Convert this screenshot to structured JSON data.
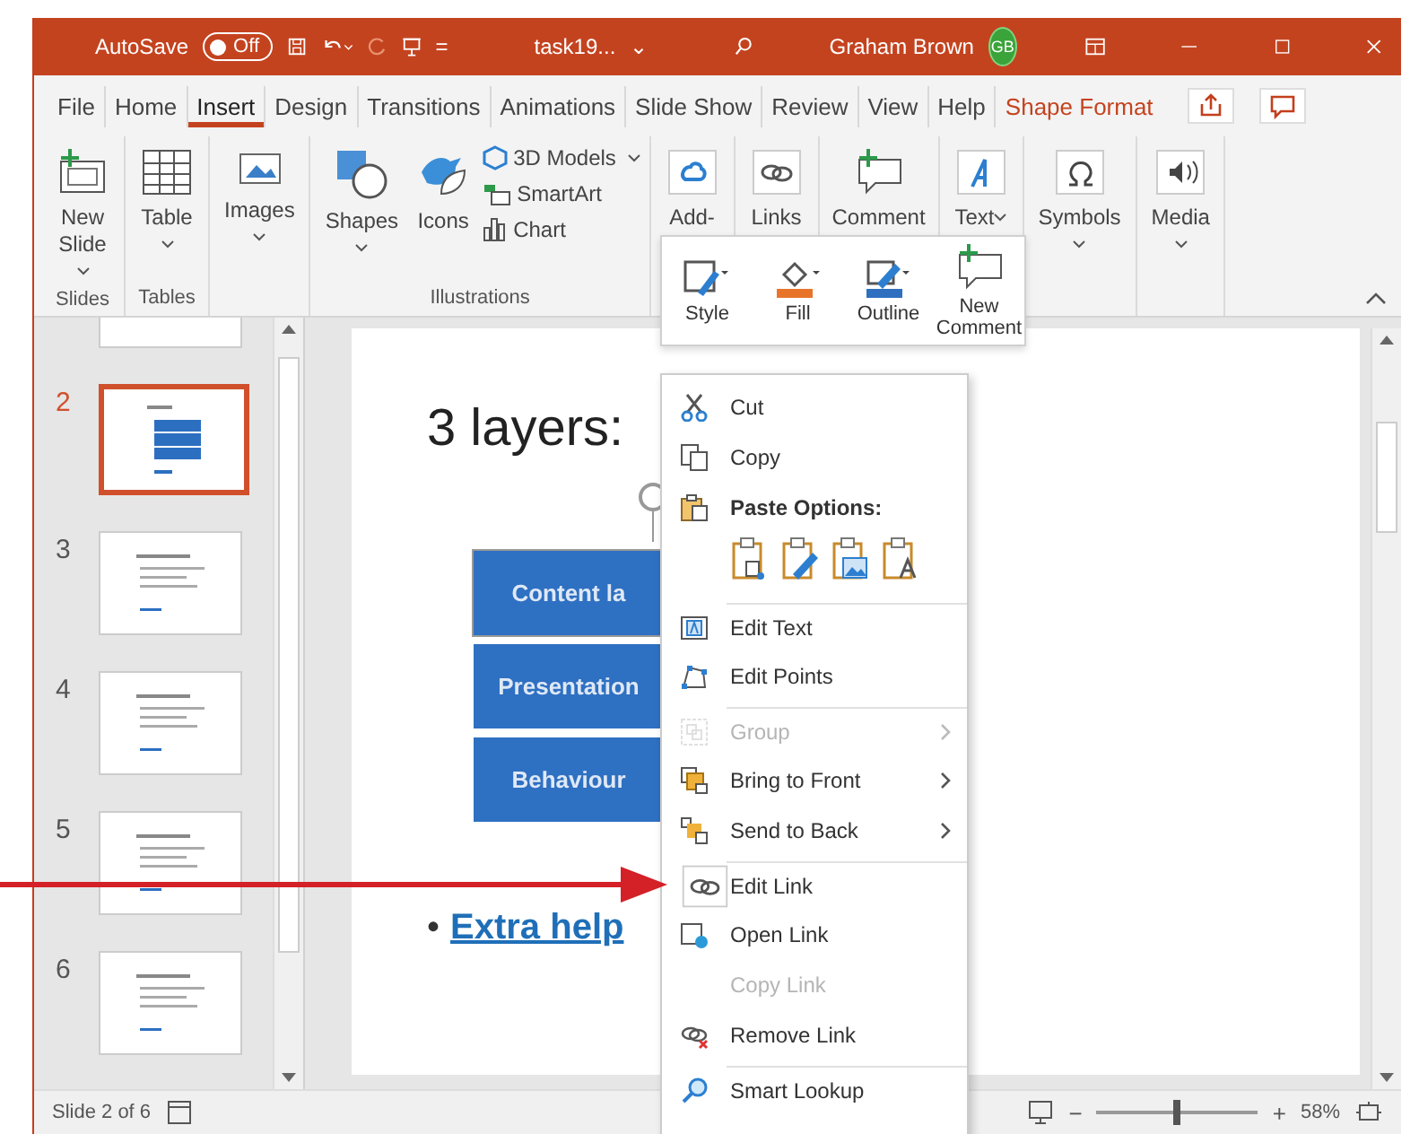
{
  "title_bar": {
    "autosave_label": "AutoSave",
    "autosave_toggle": {
      "label": "Off",
      "on": false
    },
    "customize": "=",
    "file_name": "task19...",
    "file_caret": "⌄",
    "user_name": "Graham Brown",
    "avatar": "GB"
  },
  "tabs": [
    {
      "label": "File",
      "selected": false,
      "kind": "normal"
    },
    {
      "label": "Home",
      "selected": false,
      "kind": "normal"
    },
    {
      "label": "Insert",
      "selected": true,
      "kind": "normal"
    },
    {
      "label": "Design",
      "selected": false,
      "kind": "normal"
    },
    {
      "label": "Transitions",
      "selected": false,
      "kind": "normal"
    },
    {
      "label": "Animations",
      "selected": false,
      "kind": "normal"
    },
    {
      "label": "Slide Show",
      "selected": false,
      "kind": "normal"
    },
    {
      "label": "Review",
      "selected": false,
      "kind": "normal"
    },
    {
      "label": "View",
      "selected": false,
      "kind": "normal"
    },
    {
      "label": "Help",
      "selected": false,
      "kind": "normal"
    },
    {
      "label": "Shape Format",
      "selected": false,
      "kind": "contextual"
    }
  ],
  "ribbon": {
    "groups": [
      {
        "label": "Slides",
        "buttons": [
          {
            "label": "New Slide",
            "dropdown": true
          }
        ]
      },
      {
        "label": "Tables",
        "buttons": [
          {
            "label": "Table",
            "dropdown": true
          }
        ]
      },
      {
        "buttons": [
          {
            "label": "Images",
            "dropdown": true
          }
        ]
      },
      {
        "label": "Illustrations",
        "buttons": [
          {
            "label": "Shapes",
            "dropdown": true
          },
          {
            "label": "Icons",
            "dropdown": false
          }
        ],
        "small_buttons": [
          {
            "label": "3D Models",
            "dropdown": true
          },
          {
            "label": "SmartArt",
            "dropdown": false
          },
          {
            "label": "Chart",
            "dropdown": false
          }
        ]
      },
      {
        "buttons": [
          {
            "label": "Add-",
            "dropdown": false
          }
        ]
      },
      {
        "buttons": [
          {
            "label": "Links",
            "dropdown": false
          }
        ]
      },
      {
        "buttons": [
          {
            "label": "Comment",
            "dropdown": false
          }
        ]
      },
      {
        "buttons": [
          {
            "label": "Text",
            "dropdown": true
          }
        ]
      },
      {
        "buttons": [
          {
            "label": "Symbols",
            "dropdown": true
          }
        ]
      },
      {
        "buttons": [
          {
            "label": "Media",
            "dropdown": true
          }
        ]
      }
    ]
  },
  "thumbnails": [
    {
      "kind": "partial",
      "selected": false
    },
    {
      "number": "2",
      "kind": "diagram",
      "selected": true
    },
    {
      "number": "3",
      "kind": "list",
      "selected": false
    },
    {
      "number": "4",
      "kind": "list",
      "selected": false
    },
    {
      "number": "5",
      "kind": "list",
      "selected": false
    },
    {
      "number": "6",
      "kind": "list",
      "selected": false
    }
  ],
  "slide": {
    "title": "3 layers:",
    "boxes": [
      "Content la",
      "Presentation",
      "Behaviour"
    ],
    "bullet": "•",
    "link": "Extra help"
  },
  "mini_toolbar": [
    {
      "label": "Style"
    },
    {
      "label": "Fill"
    },
    {
      "label": "Outline"
    },
    {
      "label": "New Comment"
    }
  ],
  "context_menu": [
    {
      "kind": "item",
      "label": "Cut",
      "disabled": false,
      "submenu": false,
      "separator_before": false
    },
    {
      "kind": "item",
      "label": "Copy",
      "disabled": false,
      "submenu": false,
      "separator_before": false
    },
    {
      "kind": "paste",
      "label": "Paste Options:",
      "disabled": false,
      "separator_before": false
    },
    {
      "kind": "item",
      "label": "Edit Text",
      "disabled": false,
      "submenu": false,
      "separator_before": true
    },
    {
      "kind": "item",
      "label": "Edit Points",
      "disabled": false,
      "submenu": false,
      "separator_before": false
    },
    {
      "kind": "item",
      "label": "Group",
      "disabled": true,
      "submenu": true,
      "separator_before": true
    },
    {
      "kind": "item",
      "label": "Bring to Front",
      "disabled": false,
      "submenu": true,
      "separator_before": false
    },
    {
      "kind": "item",
      "label": "Send to Back",
      "disabled": false,
      "submenu": true,
      "separator_before": false
    },
    {
      "kind": "item",
      "label": "Edit Link",
      "disabled": false,
      "submenu": false,
      "separator_before": true
    },
    {
      "kind": "item",
      "label": "Open Link",
      "disabled": false,
      "submenu": false,
      "separator_before": false
    },
    {
      "kind": "item",
      "label": "Copy Link",
      "disabled": true,
      "submenu": false,
      "separator_before": false
    },
    {
      "kind": "item",
      "label": "Remove Link",
      "disabled": false,
      "submenu": false,
      "separator_before": false
    },
    {
      "kind": "item",
      "label": "Smart Lookup",
      "disabled": false,
      "submenu": false,
      "separator_before": true
    }
  ],
  "status_bar": {
    "slide_count": "Slide 2 of 6",
    "zoom": {
      "minus": "−",
      "plus": "+",
      "level": 0.5,
      "reading": "58%"
    }
  }
}
